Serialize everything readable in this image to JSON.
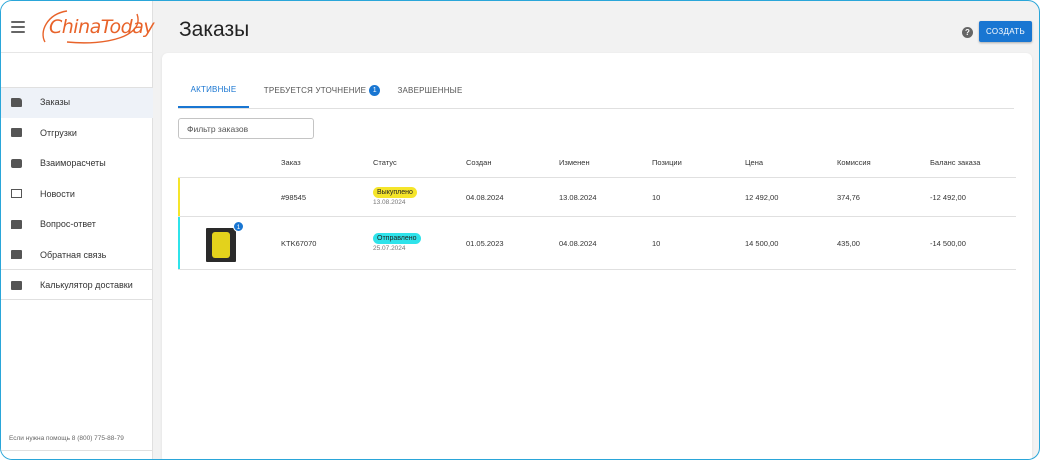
{
  "app": {
    "logo_text": "ChinaToday",
    "page_title": "Заказы",
    "help_symbol": "?",
    "create_label": "СОЗДАТЬ"
  },
  "sidebar": {
    "items": [
      {
        "label": "Заказы",
        "icon": "bag-icon",
        "active": true
      },
      {
        "label": "Отгрузки",
        "icon": "truck-icon",
        "active": false
      },
      {
        "label": "Взаиморасчеты",
        "icon": "cash-icon",
        "active": false
      },
      {
        "label": "Новости",
        "icon": "news-icon",
        "active": false
      },
      {
        "label": "Вопрос-ответ",
        "icon": "forum-icon",
        "active": false
      },
      {
        "label": "Обратная связь",
        "icon": "feedback-icon",
        "active": false
      },
      {
        "label": "Калькулятор доставки",
        "icon": "calculator-icon",
        "active": false
      }
    ],
    "help_text": "Если нужна помощь 8 (800) 775-88-79"
  },
  "tabs": [
    {
      "label": "АКТИВНЫЕ",
      "active": true
    },
    {
      "label": "ТРЕБУЕТСЯ УТОЧНЕНИЕ",
      "badge": "1",
      "active": false
    },
    {
      "label": "ЗАВЕРШЕННЫЕ",
      "active": false
    }
  ],
  "filter": {
    "placeholder": "Фильтр заказов",
    "value": ""
  },
  "table": {
    "headers": [
      "Заказ",
      "Статус",
      "Создан",
      "Изменен",
      "Позиции",
      "Цена",
      "Комиссия",
      "Баланс заказа"
    ],
    "rows": [
      {
        "order": "#98545",
        "status": "Выкуплено",
        "status_date": "13.08.2024",
        "status_color": "#f5e52a",
        "accent_color": "#f5e52a",
        "created": "04.08.2024",
        "modified": "13.08.2024",
        "positions": "10",
        "price": "12 492,00",
        "commission": "374,76",
        "balance": "-12 492,00",
        "has_thumb": false
      },
      {
        "order": "KTK67070",
        "status": "Отправлено",
        "status_date": "25.07.2024",
        "status_color": "#2fe3ea",
        "accent_color": "#2fe3ea",
        "created": "01.05.2023",
        "modified": "04.08.2024",
        "positions": "10",
        "price": "14 500,00",
        "commission": "435,00",
        "balance": "-14 500,00",
        "has_thumb": true,
        "thumb_badge": "1"
      }
    ]
  },
  "colors": {
    "accent": "#1976d2",
    "logo": "#e8632a"
  }
}
